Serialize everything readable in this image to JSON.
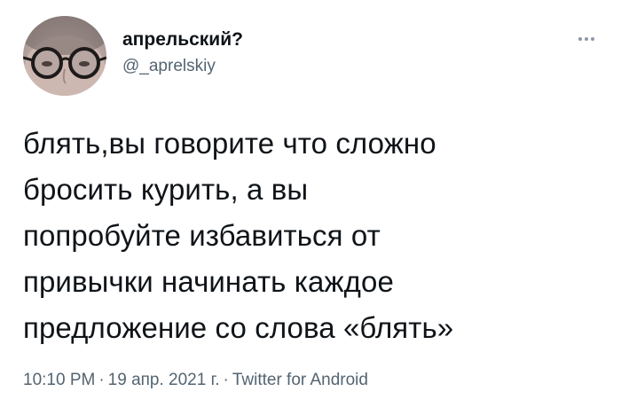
{
  "author": {
    "display_name": "апрельский?",
    "handle": "@_aprelskiy"
  },
  "tweet": {
    "text": "блять,вы говорите что сложно\nбросить курить, а вы\nпопробуйте избавиться от\nпривычки начинать каждое\nпредложение со слова «блять»"
  },
  "meta": {
    "time": "10:10 PM",
    "separator": "·",
    "date": "19 апр. 2021 г.",
    "source": "Twitter for Android"
  },
  "icons": {
    "more": "more-options-icon",
    "avatar": "avatar"
  },
  "colors": {
    "text": "#0f1419",
    "secondary": "#536471",
    "background": "#ffffff"
  }
}
